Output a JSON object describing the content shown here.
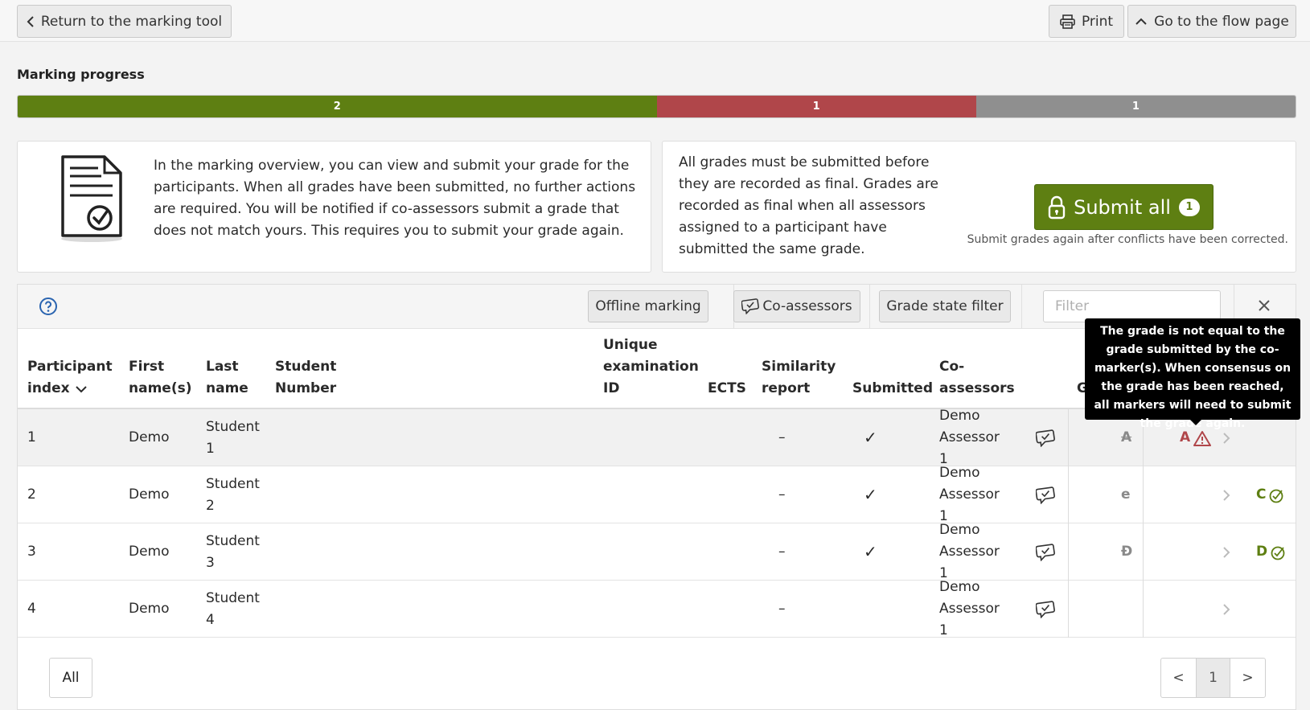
{
  "topbar": {
    "return_label": "Return to the marking tool",
    "print_label": "Print",
    "flow_label": "Go to the flow page"
  },
  "progress": {
    "title": "Marking progress",
    "segments": [
      {
        "count": "2",
        "color": "#5e7f12",
        "fraction": 0.5
      },
      {
        "count": "1",
        "color": "#b0464a",
        "fraction": 0.25
      },
      {
        "count": "1",
        "color": "#8f8f8f",
        "fraction": 0.25
      }
    ]
  },
  "info": {
    "text": "In the marking overview, you can view and submit your grade for the participants. When all grades have been submitted, no further actions are required. You will be notified if co-assessors submit a grade that does not match yours. This requires you to submit your grade again."
  },
  "submit": {
    "text": "All grades must be submitted before they are recorded as final. Grades are recorded as final when all assessors assigned to a participant have submitted the same grade.",
    "button_label": "Submit all",
    "badge": "1",
    "note": "Submit grades again after conflicts have been corrected."
  },
  "toolbar": {
    "offline_label": "Offline marking",
    "coassessors_label": "Co-assessors",
    "grade_filter_label": "Grade state filter",
    "filter_placeholder": "Filter"
  },
  "table": {
    "headers": {
      "participant_index": "Participant index",
      "first_name": "First name(s)",
      "last_name": "Last name",
      "student_number": "Student Number",
      "unique_id": "Unique examination ID",
      "ects": "ECTS",
      "similarity": "Similarity report",
      "submitted": "Submitted",
      "coassessors": "Co-assessors",
      "grade_partial": "G"
    },
    "rows": [
      {
        "index": "1",
        "first": "Demo",
        "last": "Student 1",
        "similarity": "–",
        "submitted": "✓",
        "coassessor": "Demo Assessor 1",
        "old_grade": "A",
        "current_grade": "A",
        "current_color": "#b0464a",
        "state": "conflict",
        "final_grade": ""
      },
      {
        "index": "2",
        "first": "Demo",
        "last": "Student 2",
        "similarity": "–",
        "submitted": "✓",
        "coassessor": "Demo Assessor 1",
        "old_grade": "e",
        "current_grade": "",
        "current_color": "",
        "state": "",
        "final_grade": "C"
      },
      {
        "index": "3",
        "first": "Demo",
        "last": "Student 3",
        "similarity": "–",
        "submitted": "✓",
        "coassessor": "Demo Assessor 1",
        "old_grade": "Đ",
        "current_grade": "",
        "current_color": "",
        "state": "",
        "final_grade": "D"
      },
      {
        "index": "4",
        "first": "Demo",
        "last": "Student 4",
        "similarity": "–",
        "submitted": "",
        "coassessor": "Demo Assessor 1",
        "old_grade": "",
        "current_grade": "",
        "current_color": "",
        "state": "",
        "final_grade": ""
      }
    ]
  },
  "tooltip": {
    "text": "The grade is not equal to the grade submitted by the co-marker(s). When consensus on the grade has been reached, all markers will need to submit the grade again."
  },
  "pagination": {
    "all_label": "All",
    "prev": "<",
    "current": "1",
    "next": ">"
  },
  "colors": {
    "accent_green": "#5e7f12",
    "conflict_red": "#b0464a"
  }
}
